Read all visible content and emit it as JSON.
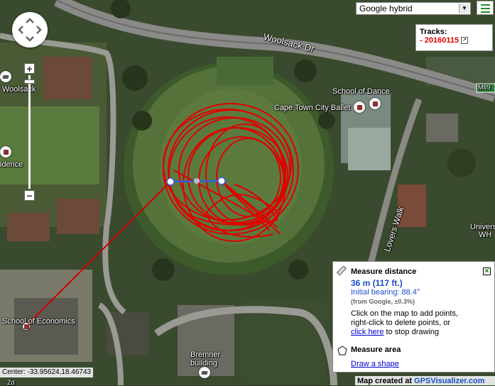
{
  "map": {
    "map_type": "Google hybrid",
    "labels": {
      "woolsack_dr": "Woolsack Dr",
      "woolsack": "Woolsack",
      "residence": "idence",
      "school_of_dance": "School of Dance",
      "cape_town_city_ballet": "Cape Town City Ballet",
      "lovers_walk": "Lovers Walk",
      "university": "Univers",
      "university2": "WH",
      "school_of_economics": "School of Economics",
      "bremner": "Bremner",
      "bremner2": "building",
      "m89": "M89",
      "bottom_road": "Zd"
    },
    "center_text": "Center: -33.95624,18.46743",
    "credit_prefix": "Map created at ",
    "credit_site": "GPSVisualizer.com",
    "track_color": "#e00000"
  },
  "tracks": {
    "heading": "Tracks:",
    "bullet": "- ",
    "name": "20160115"
  },
  "measure": {
    "distance_title": "Measure distance",
    "distance_value": "36 m  (117 ft.)",
    "bearing": "Initial bearing: 88.4°",
    "source": "(from Google, ±0.3%)",
    "instr_line1": "Click on the map to add points,",
    "instr_line2": "right-click to delete points, or",
    "click_here": "click here",
    "instr_line3_rest": " to stop drawing",
    "area_title": "Measure area",
    "draw_shape": "Draw a shape"
  },
  "controls": {
    "zoom_in": "+",
    "zoom_out": "−"
  }
}
